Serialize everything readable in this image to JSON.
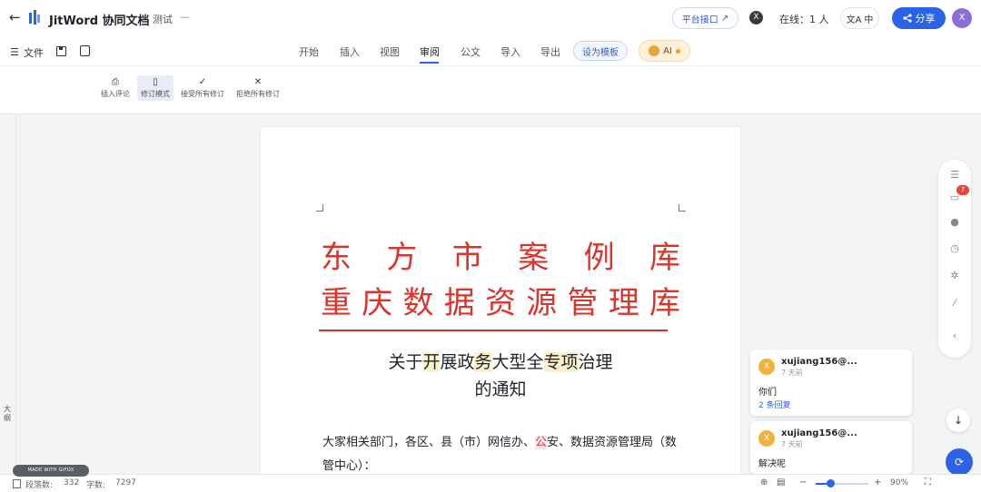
{
  "topbar": {
    "app_title": "JitWord 协同文档",
    "doc_title": "测试",
    "doc_title_suffix": "—",
    "api_button": "平台接口",
    "api_arrow": "↗",
    "close_avatar": "X",
    "online": "在线：1 人",
    "lang_icon": "文A",
    "lang": "中",
    "share": "分享",
    "user_avatar": "X"
  },
  "menubar": {
    "file": "文件",
    "tabs": [
      "开始",
      "插入",
      "视图",
      "审阅",
      "公文",
      "导入",
      "导出"
    ],
    "active_tab": "审阅",
    "template_button": "设为模板",
    "ai_button": "AI"
  },
  "toolbar": {
    "tools": [
      {
        "label": "插入评论",
        "icon": "⎙"
      },
      {
        "label": "修订模式",
        "icon": "▯"
      },
      {
        "label": "接受所有修订",
        "icon": "✓"
      },
      {
        "label": "拒绝所有修订",
        "icon": "✕"
      }
    ]
  },
  "outline": {
    "label": "大纲"
  },
  "document": {
    "header_line1": [
      "东",
      "方",
      "市",
      "案",
      "例",
      "库"
    ],
    "header_line2": [
      "重",
      "庆",
      "数",
      "据",
      "资",
      "源",
      "管",
      "理",
      "库"
    ],
    "title_line1_parts": [
      {
        "text": "关于",
        "hl": false
      },
      {
        "text": "开",
        "hl": true
      },
      {
        "text": "展政",
        "hl": false
      },
      {
        "text": "务",
        "hl": true
      },
      {
        "text": "大型全",
        "hl": false
      },
      {
        "text": "专项",
        "hl": true
      },
      {
        "text": "治理",
        "hl": false
      }
    ],
    "title_line2": "的通知",
    "body_prefix": "大家相关部门，各区、县（市）网信办、",
    "body_highlight": "公",
    "body_suffix": "安、数据资源管理局（数管中心）："
  },
  "comments": [
    {
      "avatar": "X",
      "user": "xujiang156@...",
      "time": "7 天前",
      "text": "你们",
      "replies": "2 条回复"
    },
    {
      "avatar": "X",
      "user": "xujiang156@...",
      "time": "7 天前",
      "text": "解决呢",
      "replies": ""
    }
  ],
  "rail": {
    "badge": "7"
  },
  "statusbar": {
    "made_with": "MADE WITH GIFOX",
    "paragraphs_label": "段落数:",
    "paragraphs": "332",
    "words_label": "字数:",
    "words": "7297",
    "zoom": "90%",
    "zoom_level": 0.3
  }
}
